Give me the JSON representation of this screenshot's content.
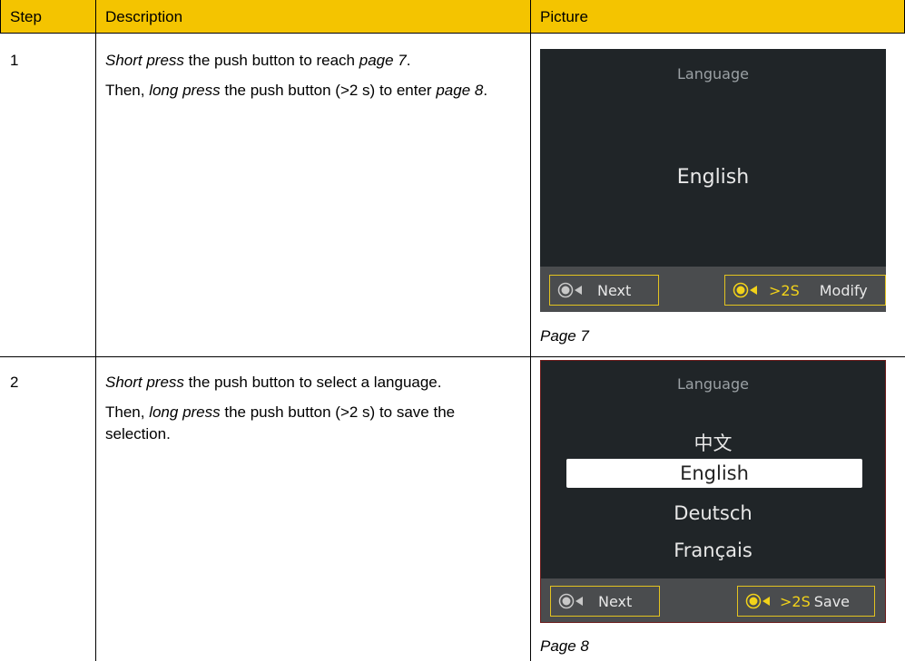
{
  "table": {
    "headers": {
      "step": "Step",
      "description": "Description",
      "picture": "Picture"
    },
    "header_color": "#f4c400"
  },
  "rows": [
    {
      "step": "1",
      "desc1_a": "Short press",
      "desc1_b": " the push button to reach ",
      "desc1_c": "page 7",
      "desc1_d": ".",
      "desc2_a": "Then, ",
      "desc2_b": "long press",
      "desc2_c": " the push button (>2 s) to enter ",
      "desc2_d": "page 8",
      "desc2_e": ".",
      "caption": "Page 7",
      "screen": {
        "title": "Language",
        "value": "English",
        "left_button": {
          "icon": "push-button-icon",
          "label": "Next"
        },
        "right_button": {
          "icon": "push-button-icon",
          "hold": ">2S",
          "label": "Modify"
        }
      }
    },
    {
      "step": "2",
      "desc1_a": "Short press",
      "desc1_b": " the push button to select a language.",
      "desc2_a": "Then, ",
      "desc2_b": "long press",
      "desc2_c": " the push button (>2 s) to save the selection.",
      "caption": "Page 8",
      "screen": {
        "title": "Language",
        "options": [
          "中文",
          "English",
          "Deutsch",
          "Français"
        ],
        "selected": "English",
        "left_button": {
          "icon": "push-button-icon",
          "label": "Next"
        },
        "right_button": {
          "icon": "push-button-icon",
          "hold": ">2S",
          "label": "Save"
        }
      }
    }
  ]
}
